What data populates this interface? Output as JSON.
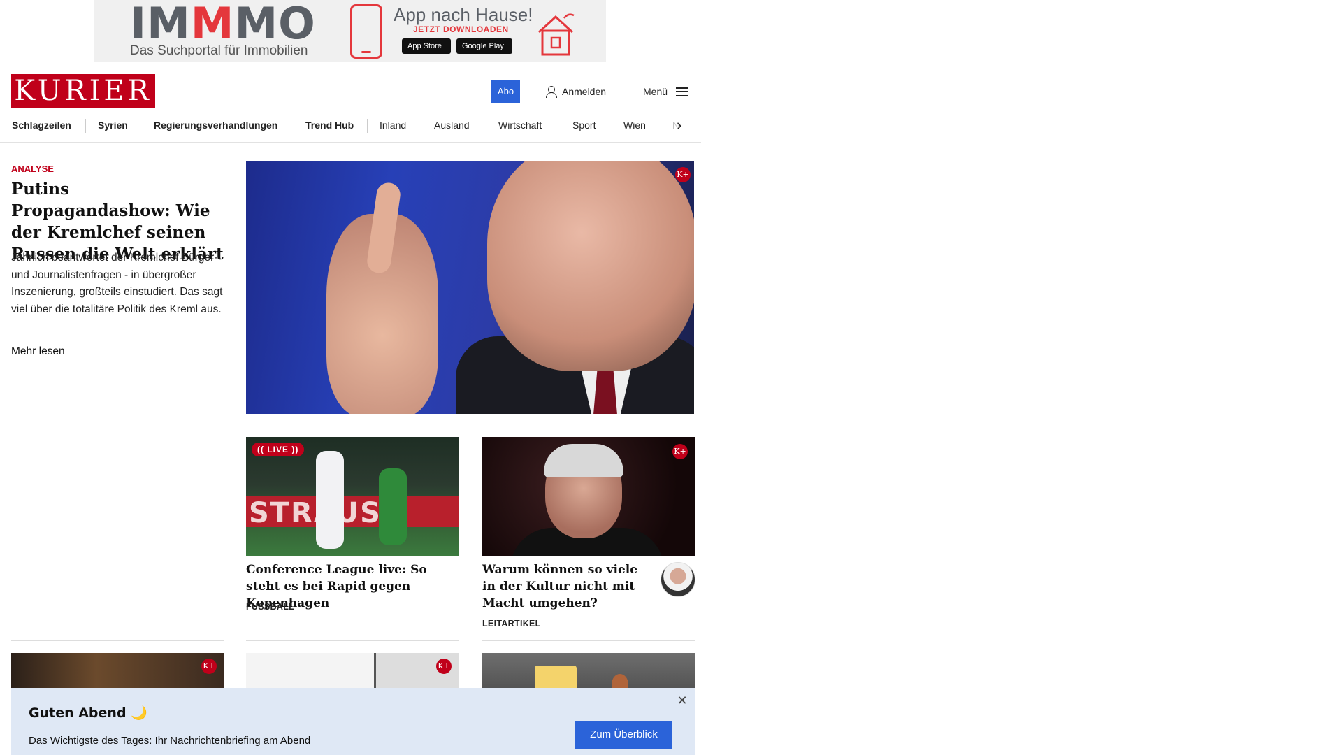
{
  "ad": {
    "logo_pre": "IM",
    "logo_m": "M",
    "logo_post": "MO",
    "subtitle": "Das Suchportal für Immobilien",
    "title": "App nach Hause!",
    "cta": "JETZT DOWNLOADEN",
    "app_store": "App Store",
    "google_play": "Google Play"
  },
  "header": {
    "logo": "KURIER",
    "abo": "Abo",
    "login": "Anmelden",
    "menu": "Menü"
  },
  "nav": {
    "items": [
      "Schlagzeilen",
      "Syrien",
      "Regierungsverhandlungen",
      "Trend Hub",
      "Inland",
      "Ausland",
      "Wirtschaft",
      "Sport",
      "Wien",
      "NÖ"
    ]
  },
  "lead": {
    "kicker": "ANALYSE",
    "title": "Putins Propagandashow: Wie der Kremlchef seinen Russen die Welt erklärt",
    "teaser": "Jährlich beantwortet der Kremlchef Bürger- und Journalistenfragen - in übergroßer Inszenierung, großteils einstudiert. Das sagt viel über die totalitäre Politik des Kreml aus.",
    "more": "Mehr lesen"
  },
  "badges": {
    "kplus": "K+",
    "live": "(( LIVE ))"
  },
  "cards": [
    {
      "title": "Conference League live: So steht es bei Rapid gegen Kopenhagen",
      "tag": "FUSSBALL",
      "image_text": "STRAUS"
    },
    {
      "title": "Warum können so viele in der Kultur nicht mit Macht umgehen?",
      "tag": "LEITARTIKEL"
    }
  ],
  "notice": {
    "title": "Guten Abend 🌙",
    "text": "Das Wichtigste des Tages: Ihr Nachrichtenbriefing am Abend",
    "button": "Zum Überblick",
    "close": "✕"
  },
  "colors": {
    "brand_red": "#c0001a",
    "accent_blue": "#2b63d9",
    "notice_bg": "#dfe8f5"
  }
}
